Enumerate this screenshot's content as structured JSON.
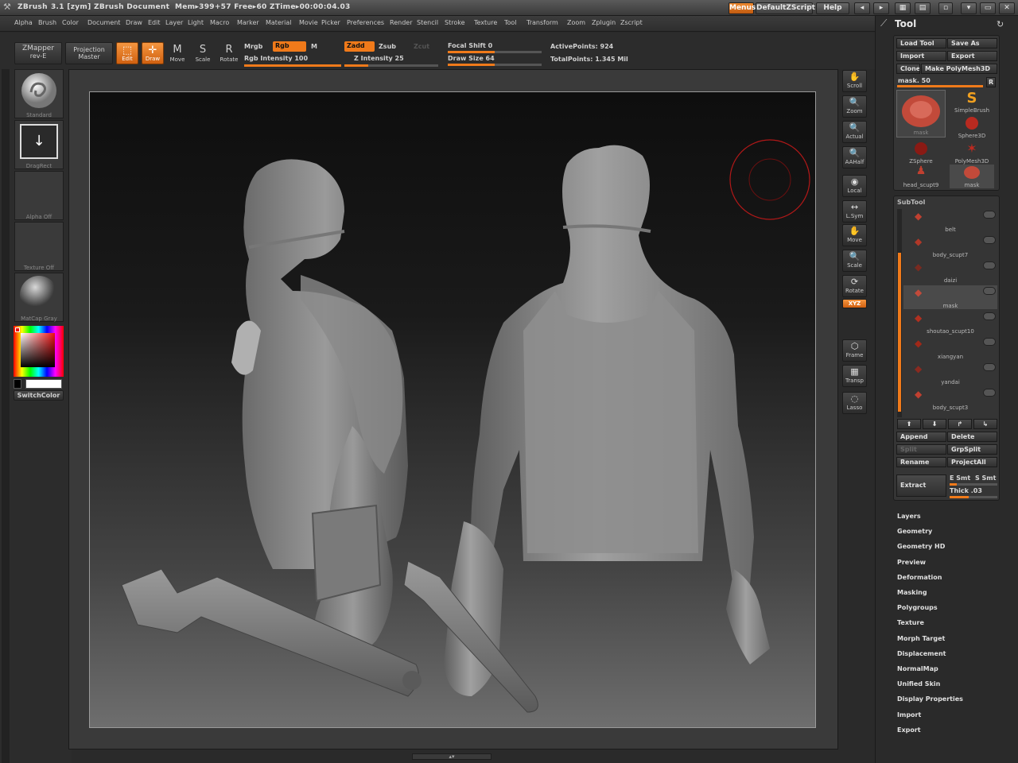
{
  "titlebar": {
    "app": "ZBrush",
    "version": "3.1 [zym]",
    "document": "ZBrush Document",
    "stats": "Mem▸399+57  Free▸60  ZTime▸00:00:04.03",
    "menus_btn": "Menus",
    "script_btn": "DefaultZScript",
    "help_btn": "Help"
  },
  "menubar": [
    "Alpha",
    "Brush",
    "Color",
    "Document",
    "Draw",
    "Edit",
    "Layer",
    "Light",
    "Macro",
    "Marker",
    "Material",
    "Movie",
    "Picker",
    "Preferences",
    "Render",
    "Stencil",
    "Stroke",
    "Texture",
    "Tool",
    "Transform",
    "Zoom",
    "Zplugin",
    "Zscript"
  ],
  "toolbar": {
    "zmapper_line1": "ZMapper",
    "zmapper_line2": "rev-E",
    "projection_line1": "Projection",
    "projection_line2": "Master",
    "edit": "Edit",
    "draw": "Draw",
    "move": "Move",
    "scale": "Scale",
    "rotate": "Rotate",
    "mrgb": "Mrgb",
    "rgb": "Rgb",
    "m": "M",
    "rgb_intensity": "Rgb  Intensity 100",
    "rgb_intensity_value": 100,
    "zadd": "Zadd",
    "zsub": "Zsub",
    "zcut": "Zcut",
    "z_intensity": "Z  Intensity 25",
    "z_intensity_value": 25,
    "focal_shift": "Focal  Shift 0",
    "focal_shift_value": 0,
    "draw_size": "Draw  Size 64",
    "draw_size_value": 64,
    "active_points": "ActivePoints: 924",
    "total_points": "TotalPoints: 1.345  Mil"
  },
  "leftshelf": {
    "brush": "Standard",
    "stroke": "DragRect",
    "alpha": "Alpha  Off",
    "texture": "Texture  Off",
    "material": "MatCap  Gray",
    "switch_color": "SwitchColor"
  },
  "rightshelf": [
    "Scroll",
    "Zoom",
    "Actual",
    "AAHalf",
    "Local",
    "L.Sym",
    "Move",
    "Scale",
    "Rotate",
    "XYZ",
    "Frame",
    "Transp",
    "Lasso"
  ],
  "toolpanel": {
    "title": "Tool",
    "load_tool": "Load  Tool",
    "save_as": "Save  As",
    "import": "Import",
    "export": "Export",
    "clone": "Clone",
    "make_polymesh": "Make  PolyMesh3D",
    "mask_label": "mask. 50",
    "mask_r": "R",
    "tools": [
      {
        "name": "mask"
      },
      {
        "name": "SimpleBrush"
      },
      {
        "name": "Sphere3D"
      },
      {
        "name": "ZSphere"
      },
      {
        "name": "PolyMesh3D"
      },
      {
        "name": "head_scupt9"
      },
      {
        "name": "mask"
      }
    ],
    "subtool_title": "SubTool",
    "subtools": [
      "belt",
      "body_scupt7",
      "daizi",
      "mask",
      "shoutao_scupt10",
      "xiangyan",
      "yandai",
      "body_scupt3"
    ],
    "append": "Append",
    "delete": "Delete",
    "split": "Split",
    "grpsplit": "GrpSplit",
    "rename": "Rename",
    "projectall": "ProjectAll",
    "extract": "Extract",
    "esmt": "E  Smt",
    "ssmt": "S  Smt",
    "thick": "Thick .03",
    "menu_items": [
      "Layers",
      "Geometry",
      "Geometry  HD",
      "Preview",
      "Deformation",
      "Masking",
      "Polygroups",
      "Texture",
      "Morph  Target",
      "Displacement",
      "NormalMap",
      "Unified  Skin",
      "Display  Properties",
      "Import",
      "Export"
    ]
  },
  "colors": {
    "accent": "#f07a1a",
    "panel": "#2a2a2a"
  }
}
